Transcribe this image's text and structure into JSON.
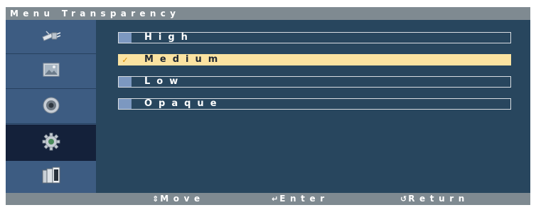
{
  "osd": {
    "title": "Menu Transparency",
    "sidebar": {
      "items": [
        {
          "name": "input",
          "icon": "plug-icon"
        },
        {
          "name": "picture",
          "icon": "picture-icon"
        },
        {
          "name": "sound",
          "icon": "speaker-icon"
        },
        {
          "name": "setup",
          "icon": "gear-icon",
          "selected": true
        },
        {
          "name": "multi-display",
          "icon": "multi-screen-icon"
        }
      ]
    },
    "options": [
      {
        "label": "High",
        "selected": false
      },
      {
        "label": "Medium",
        "selected": true,
        "mark": "✓"
      },
      {
        "label": "Low",
        "selected": false
      },
      {
        "label": "Opaque",
        "selected": false
      }
    ],
    "footer": {
      "move_icon": "⇕",
      "move_label": "Move",
      "enter_icon": "↵",
      "enter_label": "Enter",
      "return_icon": "↺",
      "return_label": "Return"
    },
    "colors": {
      "title_bar": "#7f8a91",
      "sidebar": "#3d5c82",
      "sidebar_selected": "#14213a",
      "main": "#28465e",
      "highlight": "#fbe3a1"
    }
  }
}
